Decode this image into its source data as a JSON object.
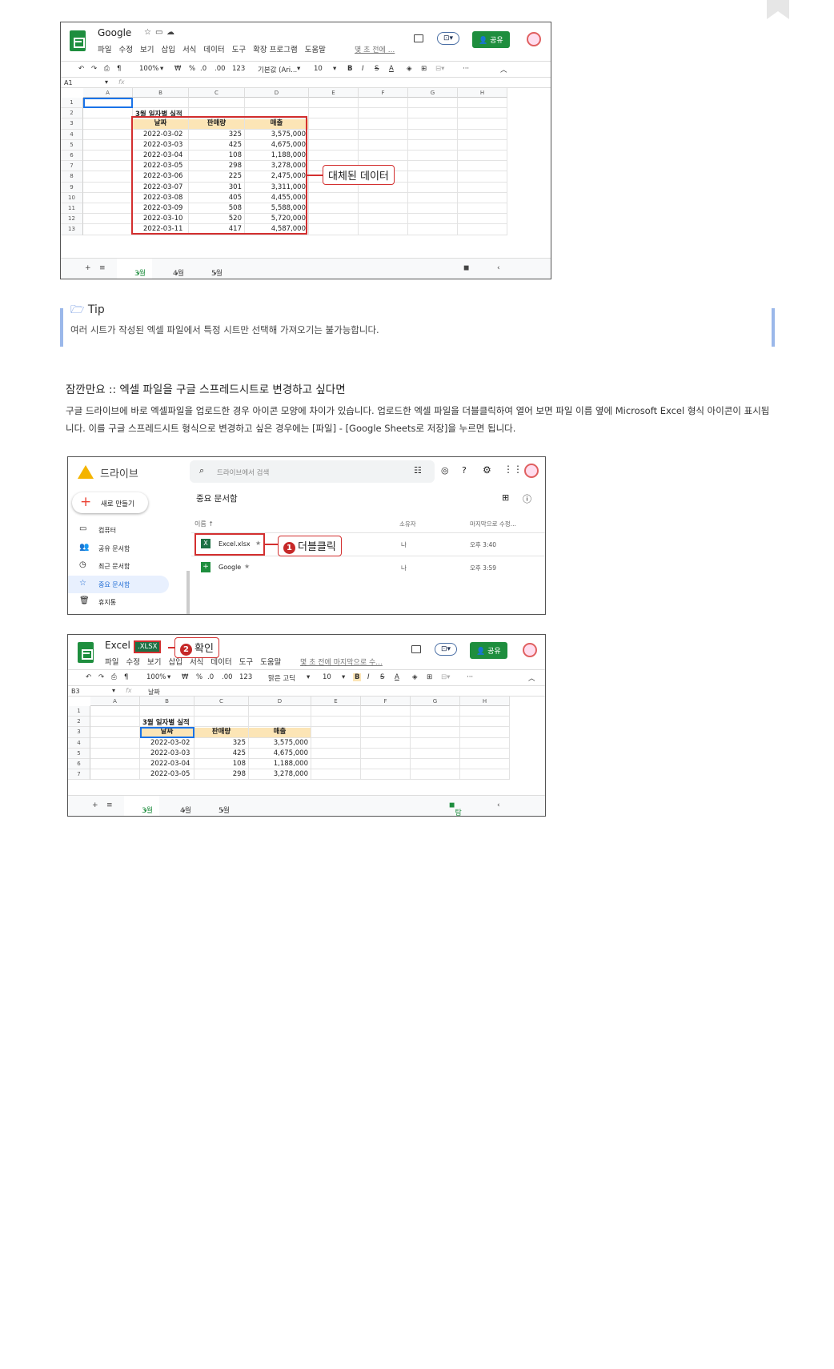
{
  "sheet1": {
    "doc_title": "Google",
    "menus": [
      "파일",
      "수정",
      "보기",
      "삽입",
      "서식",
      "데이터",
      "도구",
      "확장 프로그램",
      "도움말"
    ],
    "last_edit": "몇 초 전에 ...",
    "share_label": "공유",
    "zoom": "100%",
    "currency": "₩",
    "percent": "%",
    "dec1": ".0",
    "dec2": ".00",
    "fmt": "123",
    "font": "기본값 (Ari...",
    "font_size": "10",
    "cell_ref": "A1",
    "fx": "fx",
    "columns": [
      "A",
      "B",
      "C",
      "D",
      "E",
      "F",
      "G",
      "H"
    ],
    "rows": [
      "1",
      "2",
      "3",
      "4",
      "5",
      "6",
      "7",
      "8",
      "9",
      "10",
      "11",
      "12",
      "13"
    ],
    "table_title": "3월 일자별 실적",
    "headers": [
      "날짜",
      "판매량",
      "매출"
    ],
    "data": [
      [
        "2022-03-02",
        "325",
        "3,575,000"
      ],
      [
        "2022-03-03",
        "425",
        "4,675,000"
      ],
      [
        "2022-03-04",
        "108",
        "1,188,000"
      ],
      [
        "2022-03-05",
        "298",
        "3,278,000"
      ],
      [
        "2022-03-06",
        "225",
        "2,475,000"
      ],
      [
        "2022-03-07",
        "301",
        "3,311,000"
      ],
      [
        "2022-03-08",
        "405",
        "4,455,000"
      ],
      [
        "2022-03-09",
        "508",
        "5,588,000"
      ],
      [
        "2022-03-10",
        "520",
        "5,720,000"
      ],
      [
        "2022-03-11",
        "417",
        "4,587,000"
      ]
    ],
    "tabs": [
      "3월",
      "4월",
      "5월"
    ],
    "callout": "대체된 데이터"
  },
  "tip": {
    "title": "Tip",
    "text": "여러 시트가 작성된 엑셀 파일에서 특정 시트만 선택해 가져오기는 불가능합니다."
  },
  "section": {
    "title": "잠깐만요 :: 엑셀 파일을 구글 스프레드시트로 변경하고 싶다면",
    "para": "구글 드라이브에 바로 엑셀파일을 업로드한 경우 아이콘 모양에 차이가 있습니다. 업로드한 엑셀 파일을 더블클릭하여 열어 보면 파일 이름 옆에 Microsoft Excel 형식 아이콘이 표시됩니다. 이를 구글 스프레드시트 형식으로 변경하고 싶은 경우에는 [파일] - [Google Sheets로 저장]을 누르면 됩니다."
  },
  "drive": {
    "brand": "드라이브",
    "search_placeholder": "드라이브에서 검색",
    "new_label": "새로 만들기",
    "nav": [
      "컴퓨터",
      "공유 문서함",
      "최근 문서함",
      "중요 문서함",
      "휴지통"
    ],
    "heading": "중요 문서함",
    "col_name": "이름",
    "col_owner": "소유자",
    "col_modified": "마지막으로 수정...",
    "files": [
      {
        "name": "Excel.xlsx",
        "owner": "나",
        "modified": "오후 3:40"
      },
      {
        "name": "Google",
        "owner": "나",
        "modified": "오후 3:59"
      }
    ],
    "callout_num": "1",
    "callout": "더블클릭"
  },
  "sheet2": {
    "doc_title": "Excel",
    "badge": ".XLSX",
    "callout_num": "2",
    "callout": "확인",
    "menus": [
      "파일",
      "수정",
      "보기",
      "삽입",
      "서식",
      "데이터",
      "도구",
      "도움말"
    ],
    "last_edit": "몇 초 전에 마지막으로 수...",
    "share_label": "공유",
    "zoom": "100%",
    "currency": "₩",
    "percent": "%",
    "dec1": ".0",
    "dec2": ".00",
    "fmt": "123",
    "font": "맑은 고딕",
    "font_size": "10",
    "cell_ref": "B3",
    "fx": "fx",
    "formula": "날짜",
    "columns": [
      "A",
      "B",
      "C",
      "D",
      "E",
      "F",
      "G",
      "H"
    ],
    "rows": [
      "1",
      "2",
      "3",
      "4",
      "5",
      "6",
      "7"
    ],
    "table_title": "3월 일자별 실적",
    "headers": [
      "날짜",
      "판매량",
      "매출"
    ],
    "data": [
      [
        "2022-03-02",
        "325",
        "3,575,000"
      ],
      [
        "2022-03-03",
        "425",
        "4,675,000"
      ],
      [
        "2022-03-04",
        "108",
        "1,188,000"
      ],
      [
        "2022-03-05",
        "298",
        "3,278,000"
      ]
    ],
    "tabs": [
      "3월",
      "4월",
      "5월"
    ],
    "explore": "탐색"
  }
}
